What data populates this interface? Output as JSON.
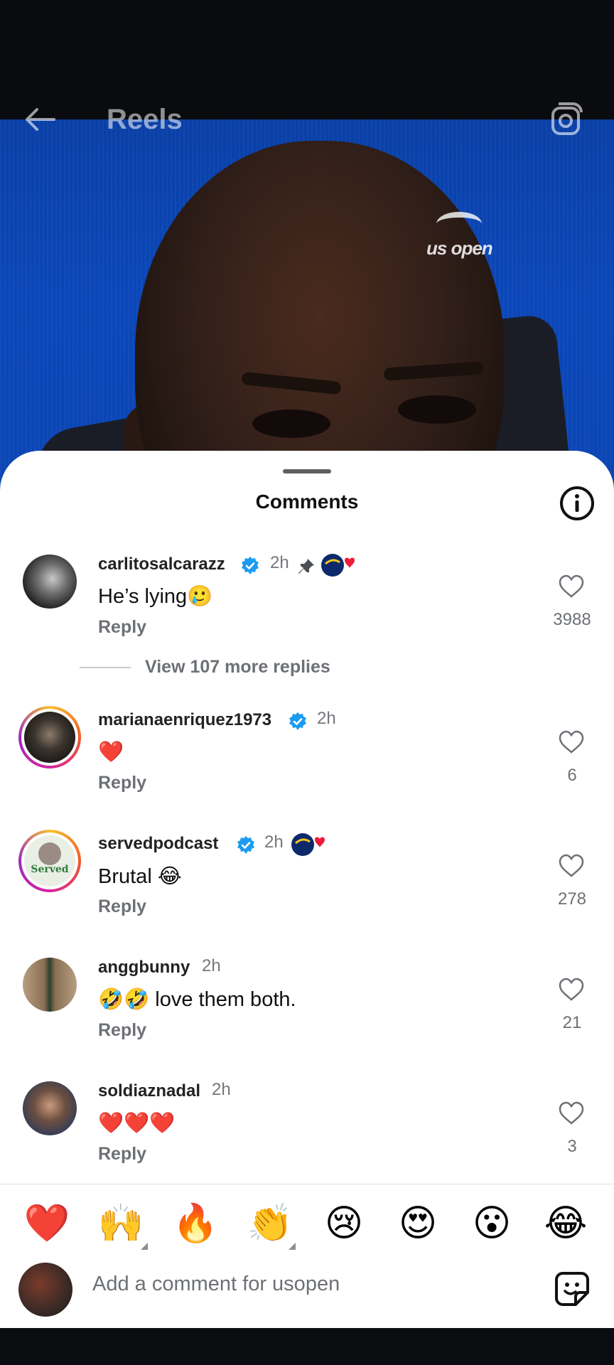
{
  "header": {
    "title": "Reels"
  },
  "video": {
    "watermark": "us open"
  },
  "sheet": {
    "title": "Comments"
  },
  "comments": [
    {
      "username": "carlitosalcarazz",
      "verified": true,
      "time": "2h",
      "pinned": true,
      "liked_by_author": true,
      "text": "He’s lying🥲",
      "reply": "Reply",
      "likes": "3988",
      "avatar": "portrait-bw"
    },
    {
      "username": "marianaenriquez1973",
      "verified": true,
      "time": "2h",
      "text": "❤️",
      "reply": "Reply",
      "likes": "6",
      "avatar": "person-dark-outfit"
    },
    {
      "username": "servedpodcast",
      "verified": true,
      "time": "2h",
      "liked_by_author": true,
      "text": "Brutal 😂",
      "reply": "Reply",
      "likes": "278",
      "avatar": "served-logo"
    },
    {
      "username": "anggbunny",
      "verified": false,
      "time": "2h",
      "text": "🤣🤣 love them both.",
      "reply": "Reply",
      "likes": "21",
      "avatar": "person-standing"
    },
    {
      "username": "soldiaznadal",
      "verified": false,
      "time": "2h",
      "text": "❤️❤️❤️",
      "reply": "Reply",
      "likes": "3",
      "avatar": "person-selfie"
    }
  ],
  "view_more": "View 107 more replies",
  "avatar_text": {
    "served": "Served"
  },
  "quick_reactions": [
    "❤️",
    "🙌",
    "🔥",
    "👏",
    "😢",
    "😍",
    "😮",
    "😂"
  ],
  "composer": {
    "placeholder": "Add a comment for usopen"
  },
  "colors": {
    "verified": "#1d9bf0",
    "accent": "#0a45b3"
  }
}
